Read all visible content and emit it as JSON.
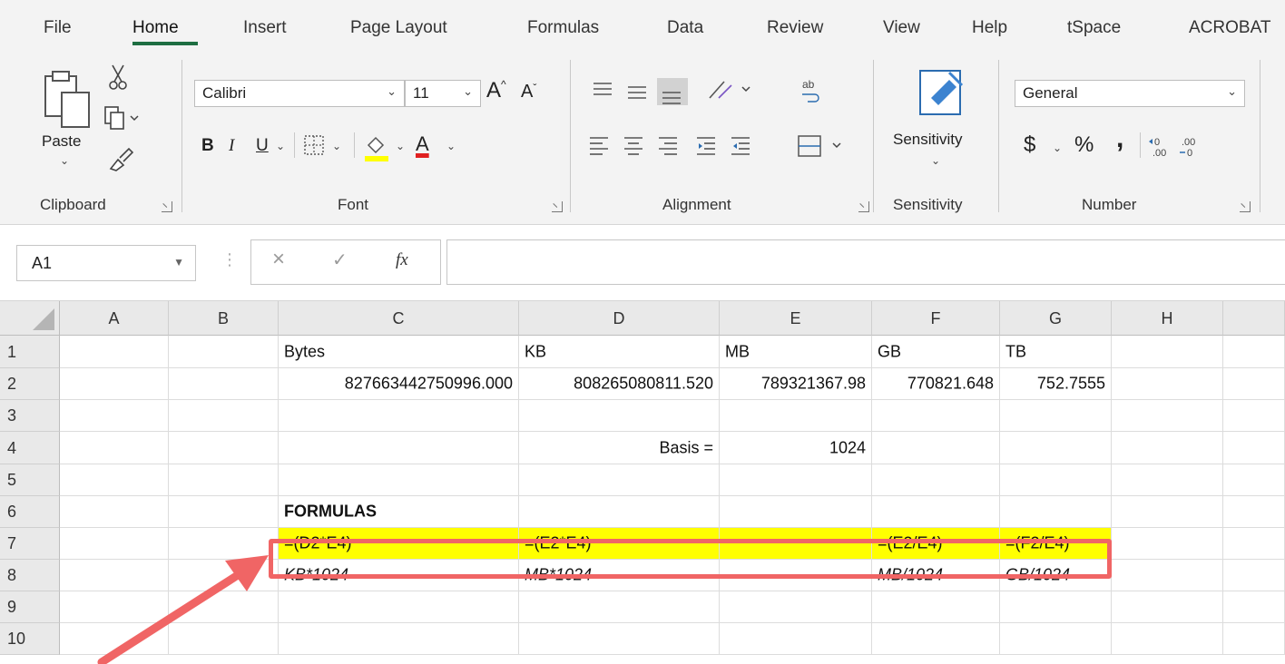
{
  "menu": {
    "tabs": [
      {
        "label": "File"
      },
      {
        "label": "Home"
      },
      {
        "label": "Insert"
      },
      {
        "label": "Page Layout"
      },
      {
        "label": "Formulas"
      },
      {
        "label": "Data"
      },
      {
        "label": "Review"
      },
      {
        "label": "View"
      },
      {
        "label": "Help"
      },
      {
        "label": "tSpace"
      },
      {
        "label": "ACROBAT"
      }
    ],
    "active": "Home"
  },
  "ribbon": {
    "clipboard": {
      "paste_label": "Paste",
      "group_label": "Clipboard"
    },
    "font": {
      "font_name": "Calibri",
      "font_size": "11",
      "bold": "B",
      "italic": "I",
      "underline": "U",
      "font_color_letter": "A",
      "grow": "A",
      "shrink": "A",
      "group_label": "Font",
      "highlight_color": "#ffff00",
      "font_color": "#e02020"
    },
    "alignment": {
      "group_label": "Alignment"
    },
    "sensitivity": {
      "button_label": "Sensitivity",
      "group_label": "Sensitivity"
    },
    "number": {
      "format": "General",
      "currency": "$",
      "percent": "%",
      "comma": ",",
      "group_label": "Number"
    }
  },
  "formula_bar": {
    "name_box": "A1",
    "fx": "fx",
    "cancel": "×",
    "enter": "✓",
    "content": ""
  },
  "grid": {
    "columns": [
      "A",
      "B",
      "C",
      "D",
      "E",
      "F",
      "G",
      "H"
    ],
    "rows": [
      "1",
      "2",
      "3",
      "4",
      "5",
      "6",
      "7",
      "8",
      "9",
      "10"
    ],
    "r1": {
      "C": "Bytes",
      "D": "KB",
      "E": "MB",
      "F": "GB",
      "G": "TB"
    },
    "r2": {
      "C": "827663442750996.000",
      "D": "808265080811.520",
      "E": "789321367.98",
      "F": "770821.648",
      "G": "752.7555"
    },
    "r4": {
      "D": "Basis =",
      "E": "1024"
    },
    "r6": {
      "C": "FORMULAS"
    },
    "r7": {
      "C": "=(D2*E4)",
      "D": "=(E2*E4)",
      "F": "=(E2/E4)",
      "G": "=(F2/E4)"
    },
    "r8": {
      "C": "KB*1024",
      "D": "MB*1024",
      "F": "MB/1024",
      "G": "GB/1024"
    }
  },
  "colors": {
    "accent": "#1e6e42",
    "row7_fill": "#ffff00",
    "annotation": "#f06565"
  }
}
